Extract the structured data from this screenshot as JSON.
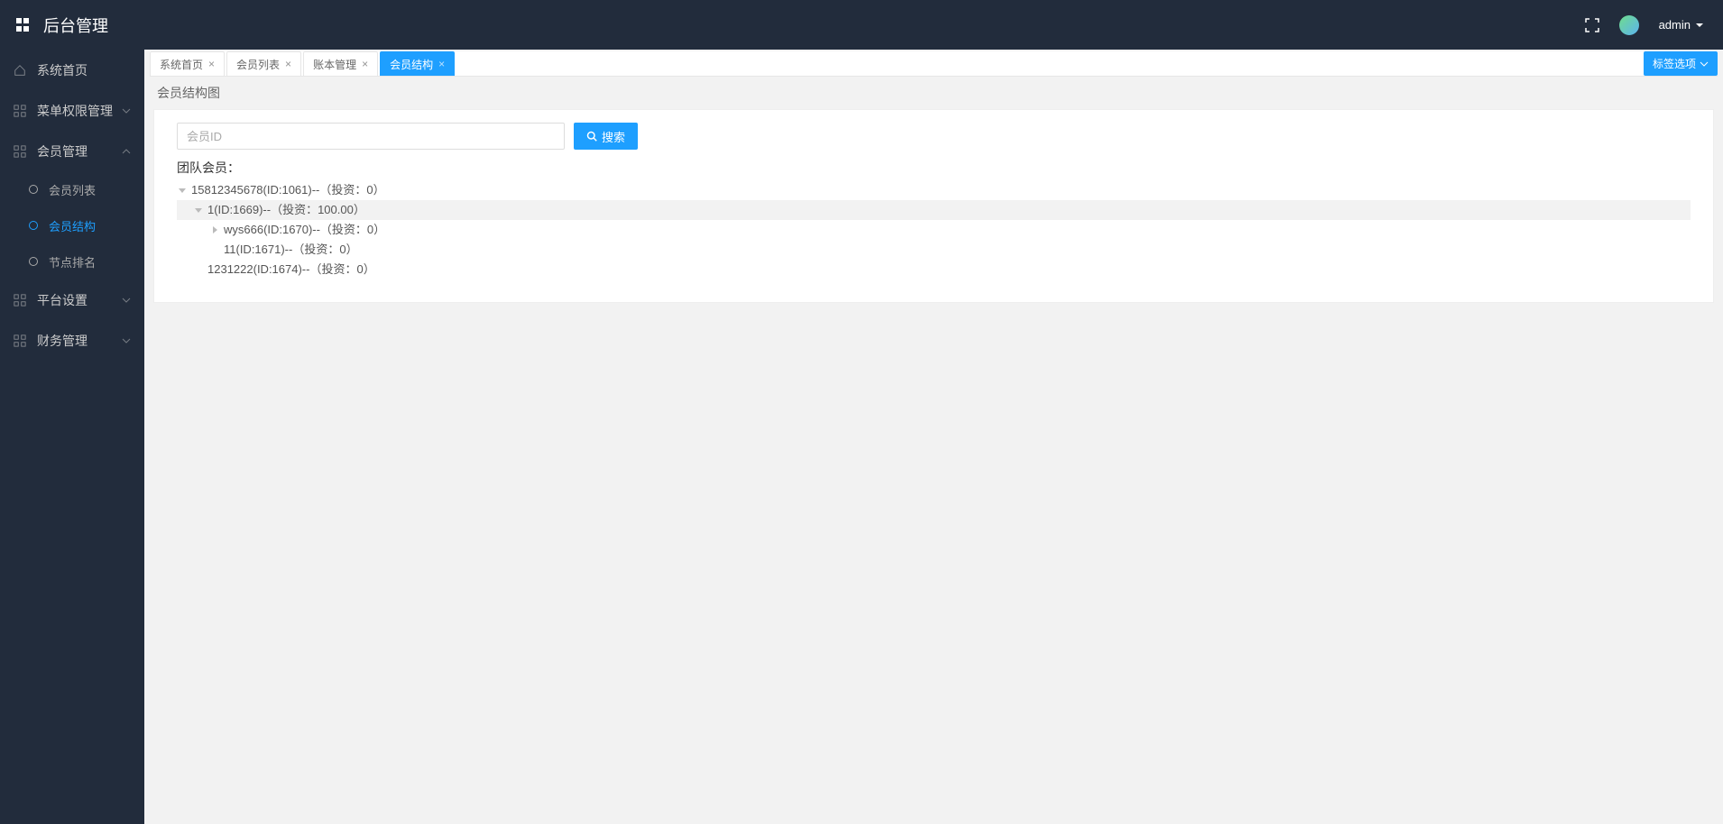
{
  "header": {
    "title": "后台管理",
    "user": "admin"
  },
  "sidebar": {
    "items": [
      {
        "label": "系统首页",
        "type": "link"
      },
      {
        "label": "菜单权限管理",
        "type": "group",
        "expanded": false
      },
      {
        "label": "会员管理",
        "type": "group",
        "expanded": true,
        "children": [
          {
            "label": "会员列表",
            "active": false
          },
          {
            "label": "会员结构",
            "active": true
          },
          {
            "label": "节点排名",
            "active": false
          }
        ]
      },
      {
        "label": "平台设置",
        "type": "group",
        "expanded": false
      },
      {
        "label": "财务管理",
        "type": "group",
        "expanded": false
      }
    ]
  },
  "tabs": {
    "list": [
      {
        "label": "系统首页",
        "closable": true,
        "active": false
      },
      {
        "label": "会员列表",
        "closable": true,
        "active": false
      },
      {
        "label": "账本管理",
        "closable": true,
        "active": false
      },
      {
        "label": "会员结构",
        "closable": true,
        "active": true
      }
    ],
    "options_label": "标签选项"
  },
  "page": {
    "title": "会员结构图",
    "search": {
      "placeholder": "会员ID",
      "button": "搜索"
    },
    "team_title": "团队会员：",
    "tree": [
      {
        "level": 1,
        "expand": "open",
        "selected": false,
        "text": "15812345678(ID:1061)--（投资：0）"
      },
      {
        "level": 2,
        "expand": "open",
        "selected": true,
        "text": "1(ID:1669)--（投资：100.00）"
      },
      {
        "level": 3,
        "expand": "closed",
        "selected": false,
        "text": "wys666(ID:1670)--（投资：0）"
      },
      {
        "level": 3,
        "expand": "none",
        "selected": false,
        "text": "11(ID:1671)--（投资：0）"
      },
      {
        "level": 2,
        "expand": "none",
        "selected": false,
        "text": "1231222(ID:1674)--（投资：0）"
      }
    ]
  }
}
